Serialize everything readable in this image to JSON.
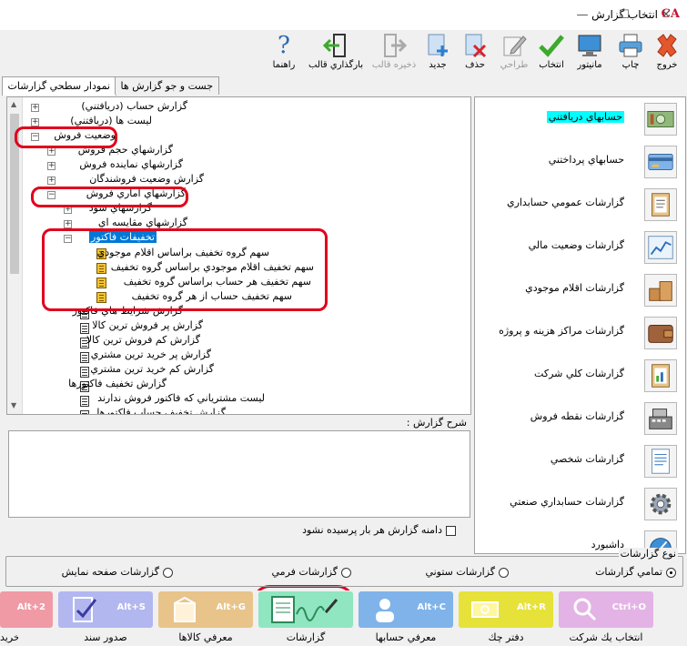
{
  "window": {
    "title": "انتخاب گزارش",
    "app_logo": "CA",
    "minimize": "—",
    "maximize": "☐",
    "close": "✕"
  },
  "toolbar": {
    "exit": "خروج",
    "print": "چاپ",
    "monitor": "مانيتور",
    "select": "انتخاب",
    "design": "طراحي",
    "delete": "حذف",
    "new": "جديد",
    "save_template": "ذخيره قالب",
    "load_template": "بارگذاري قالب",
    "help": "راهنما",
    "help_icon_glyph": "?"
  },
  "tabs": {
    "levels": "نمودار سطحي گزارشات",
    "search": "جست و جو گزارش ها"
  },
  "tree": {
    "items": [
      "گزارش حساب (دريافتني)",
      "ليست ها (دريافتني)",
      "وضعيت فروش",
      "گزارشهاي حجم فروش",
      "گزارشهاي نماينده فروش",
      "گزارش وضعيت فروشندگان",
      "گزارشهاي اماري فروش",
      "گزارشهاي سود",
      "گزارشهاي مقايسه اي",
      "تخفيفات فاكتور",
      "سهم گروه تخفيف براساس اقلام موجودي",
      "سهم تخفيف اقلام موجودي براساس گروه تخفيف",
      "سهم تخفيف هر حساب براساس گروه تخفيف",
      "سهم تخفيف حساب از هر گروه تخفيف",
      "گزارش شرايط هاي فاكتور",
      "گزارش پر فروش ترين كالا",
      "گزارش كم فروش ترين كالا",
      "گزارش پر خريد ترين مشتري",
      "گزارش كم خريد ترين مشتري",
      "گزارش تخفيف فاكتورها",
      "ليست مشترياني كه فاكتور فروش ندارند",
      "گزارش تخفيف حساب فاكتورها"
    ]
  },
  "description": {
    "label": "شرح گزارش :",
    "value": ""
  },
  "continue_checkbox": {
    "label": "دامنه گزارش هر بار پرسيده نشود",
    "checked": false
  },
  "categories": [
    "حسابهاي دريافتني",
    "حسابهاي پرداختني",
    "گزارشات عمومي حسابداري",
    "گزارشات وضعيت مالي",
    "گزارشات اقلام موجودي",
    "گزارشات مراكز هزينه و پروژه",
    "گزارشات كلي شركت",
    "گزارشات نقطه فروش",
    "گزارشات شخصي",
    "گزارشات حسابداري صنعتي",
    "داشبورد"
  ],
  "report_type": {
    "title": "نوع گزارشات",
    "options": [
      "تمامي گزارشات",
      "گزارشات ستوني",
      "گزارشات فرمي",
      "گزارشات صفحه نمايش"
    ],
    "selected": "تمامي گزارشات"
  },
  "bottom_buttons": [
    {
      "label": "انتخاب يك شركت",
      "shortcut": "Ctrl+O",
      "color": "#e3b3e6"
    },
    {
      "label": "دفتر چك",
      "shortcut": "Alt+R",
      "color": "#e6e23a"
    },
    {
      "label": "معرفي حسابها",
      "shortcut": "Alt+C",
      "color": "#7fb3ea"
    },
    {
      "label": "گزارشات",
      "shortcut": "",
      "color": "#8fe6c0"
    },
    {
      "label": "معرفي كالاها",
      "shortcut": "Alt+G",
      "color": "#e8c48a"
    },
    {
      "label": "صدور سند",
      "shortcut": "Alt+S",
      "color": "#b3b7f0"
    },
    {
      "label": "خريد",
      "shortcut": "Alt+2",
      "color": "#f09aa6"
    }
  ]
}
